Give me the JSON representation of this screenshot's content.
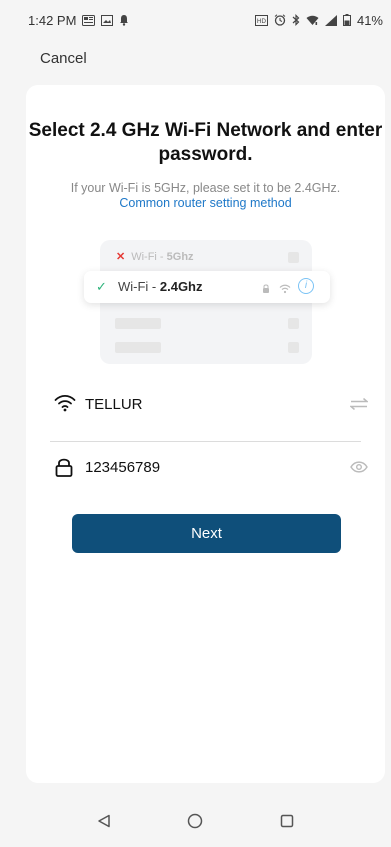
{
  "status_bar": {
    "time": "1:42 PM",
    "battery": "41%"
  },
  "header": {
    "cancel_label": "Cancel"
  },
  "card": {
    "title": "Select 2.4 GHz Wi-Fi Network and enter password.",
    "subtitle": "If your Wi-Fi is 5GHz, please set it to be 2.4GHz.",
    "link": "Common router setting method",
    "illustration": {
      "row_5ghz_prefix": "Wi-Fi - ",
      "row_5ghz_band": "5Ghz",
      "row_24ghz_prefix": "Wi-Fi - ",
      "row_24ghz_band": "2.4Ghz"
    },
    "wifi_field": {
      "value": "TELLUR",
      "icon": "wifi-icon",
      "action_icon": "switch-network-icon"
    },
    "password_field": {
      "value": "123456789",
      "icon": "lock-icon",
      "action_icon": "eye-icon"
    },
    "next_label": "Next"
  },
  "colors": {
    "accent": "#0f4f7a",
    "link": "#1e78c8",
    "check": "#2db37b",
    "error": "#e53935"
  }
}
